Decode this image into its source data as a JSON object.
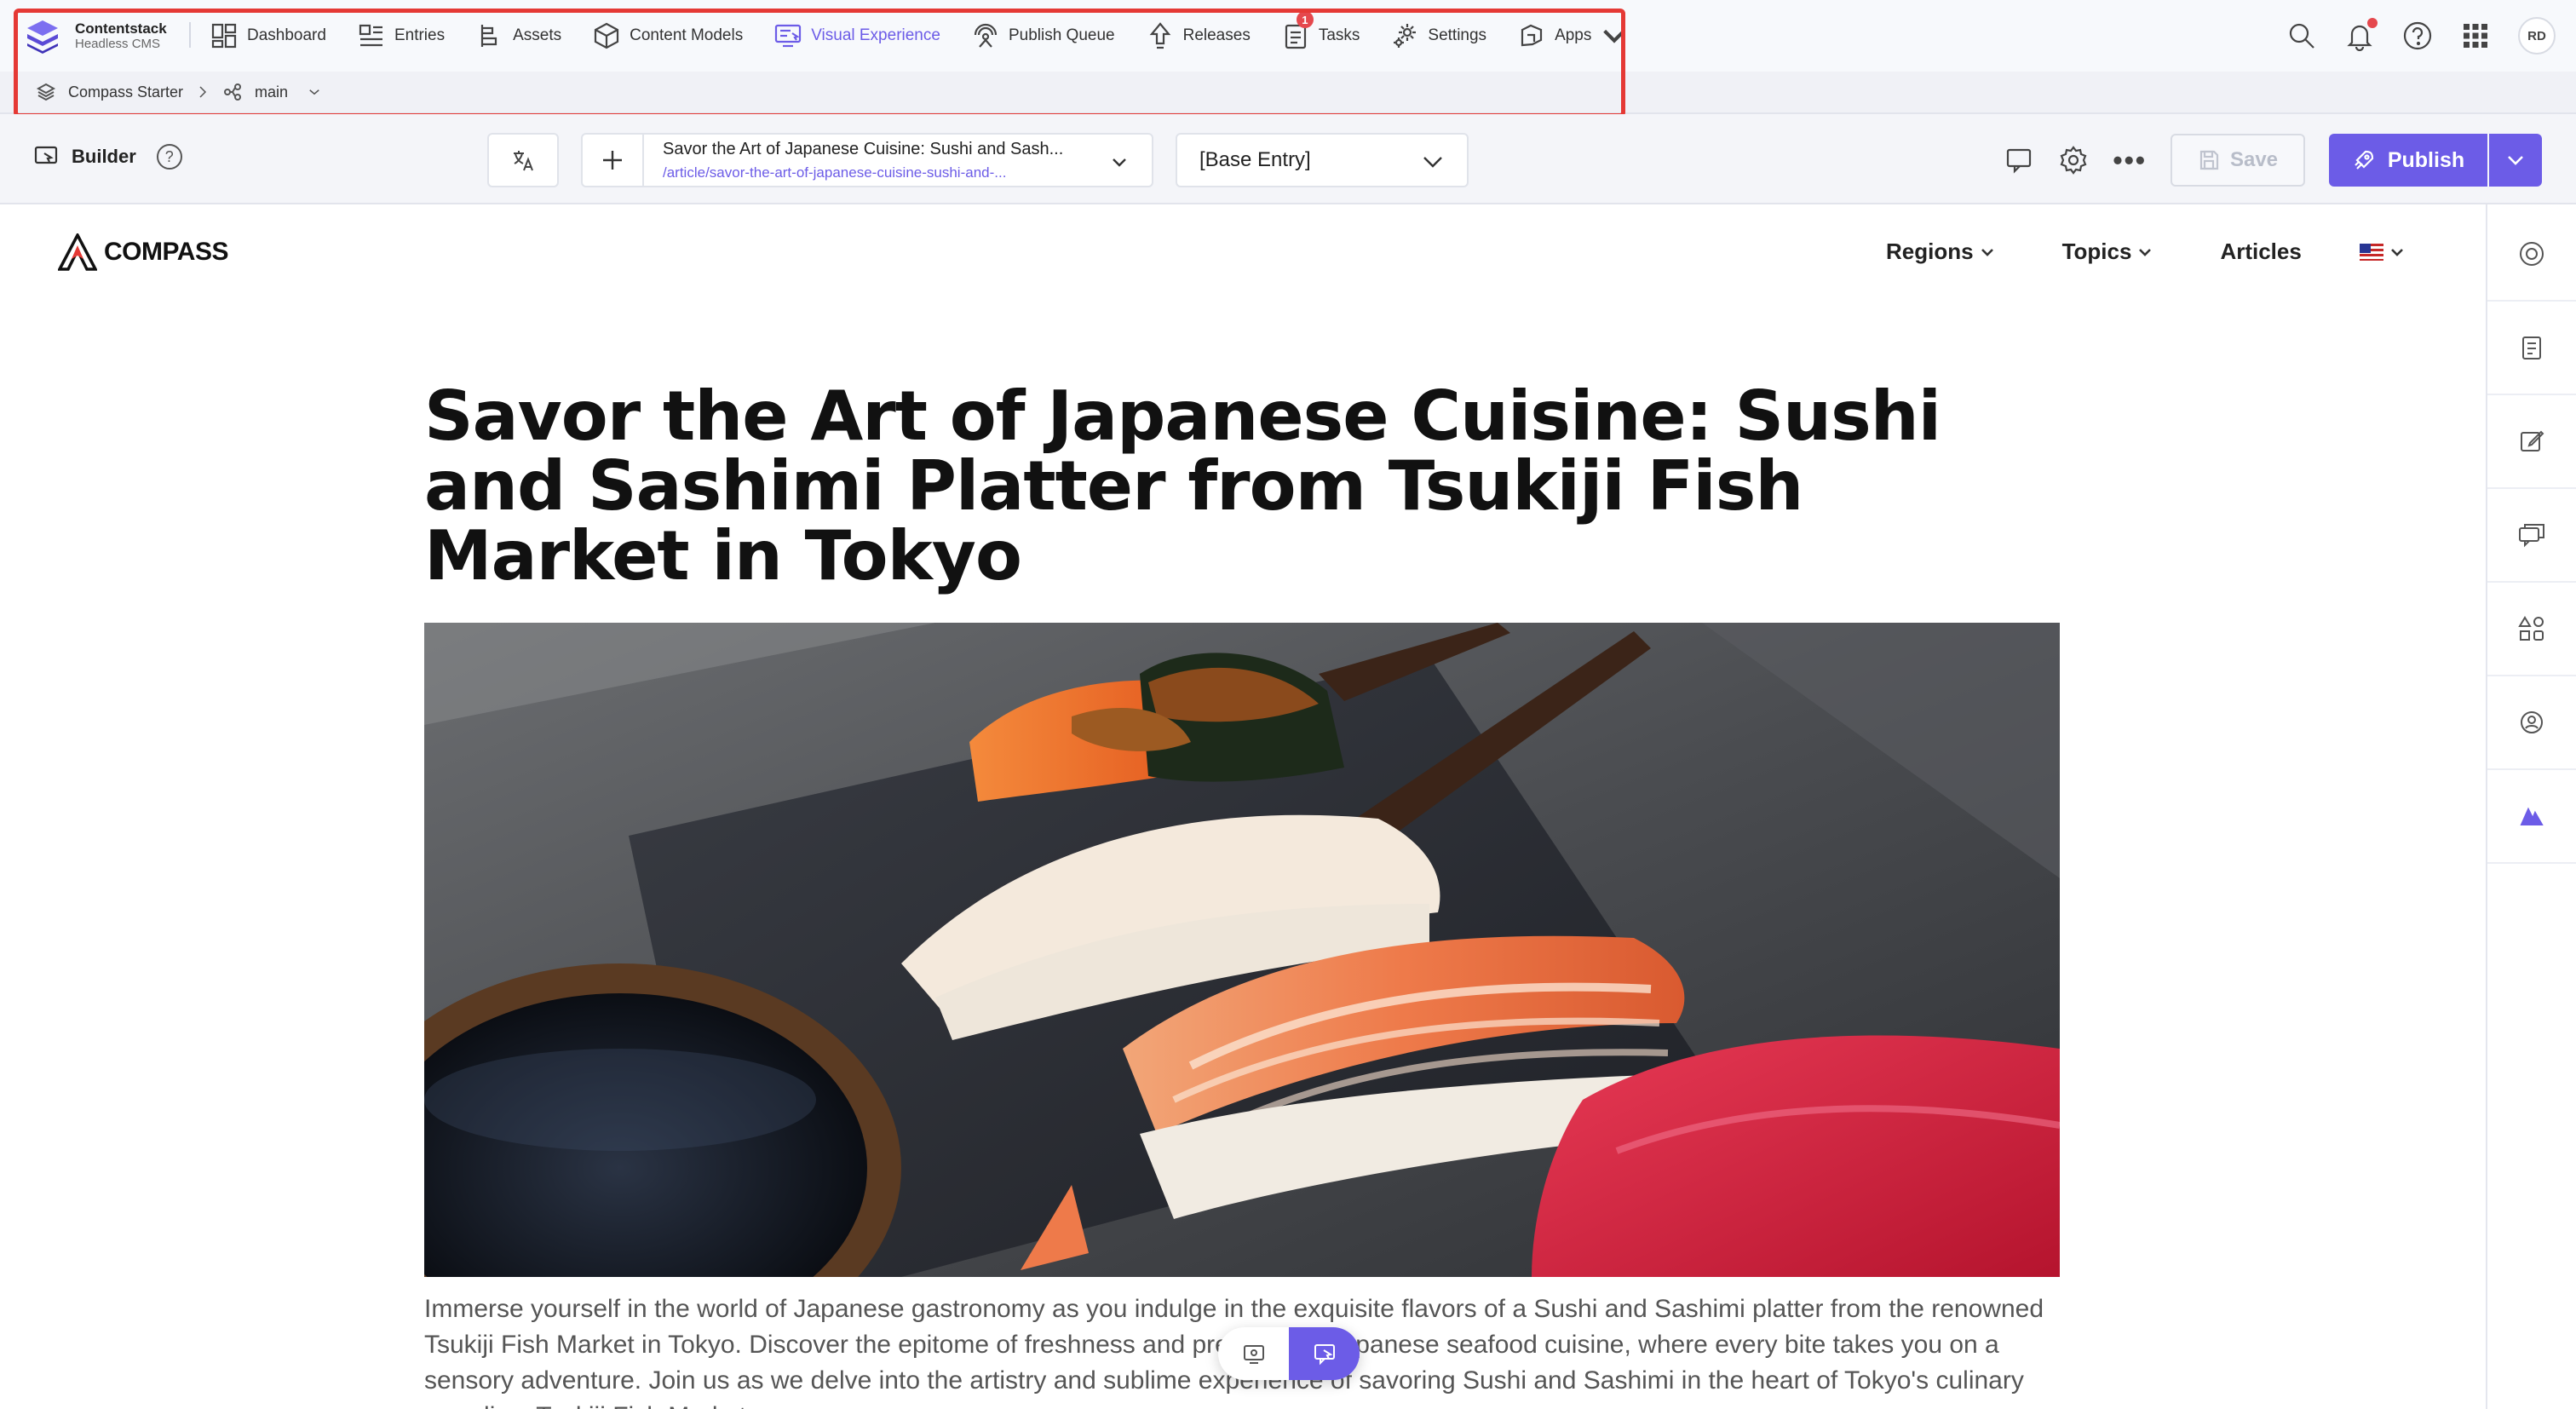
{
  "brand": {
    "name": "Contentstack",
    "sub": "Headless CMS"
  },
  "nav": {
    "items": [
      {
        "label": "Dashboard",
        "icon": "dashboard-icon"
      },
      {
        "label": "Entries",
        "icon": "entries-icon"
      },
      {
        "label": "Assets",
        "icon": "assets-icon"
      },
      {
        "label": "Content Models",
        "icon": "content-models-icon"
      },
      {
        "label": "Visual Experience",
        "icon": "visual-experience-icon",
        "active": true
      },
      {
        "label": "Publish Queue",
        "icon": "publish-queue-icon"
      },
      {
        "label": "Releases",
        "icon": "releases-icon"
      },
      {
        "label": "Tasks",
        "icon": "tasks-icon",
        "badge": "1"
      },
      {
        "label": "Settings",
        "icon": "settings-icon"
      },
      {
        "label": "Apps",
        "icon": "apps-icon"
      }
    ],
    "user_initials": "RD"
  },
  "breadcrumb": {
    "stack": "Compass Starter",
    "branch": "main"
  },
  "toolbar": {
    "builder_label": "Builder",
    "help": "?",
    "entry_title": "Savor the Art of Japanese Cuisine: Sushi and Sash...",
    "entry_url": "/article/savor-the-art-of-japanese-cuisine-sushi-and-...",
    "variant": "[Base Entry]",
    "more": "•••",
    "save_label": "Save",
    "publish_label": "Publish"
  },
  "site": {
    "logo": "COMPASS",
    "nav": [
      {
        "label": "Regions",
        "dropdown": true
      },
      {
        "label": "Topics",
        "dropdown": true
      },
      {
        "label": "Articles",
        "dropdown": false
      }
    ],
    "locale_flag": "us-flag-icon"
  },
  "article": {
    "title": "Savor the Art of Japanese Cuisine: Sushi and Sashimi Platter from Tsukiji Fish Market in Tokyo",
    "body": "Immerse yourself in the world of Japanese gastronomy as you indulge in the exquisite flavors of a Sushi and Sashimi platter from the renowned Tsukiji Fish Market in Tokyo. Discover the epitome of freshness and precision in Japanese seafood cuisine, where every bite takes you on a sensory adventure. Join us as we delve into the artistry and sublime experience of savoring Sushi and Sashimi in the heart of Tokyo's culinary paradise: Tsukiji Fish Market."
  },
  "colors": {
    "accent": "#6c5ce7",
    "highlight": "#e53935",
    "badge": "#e5484d"
  }
}
